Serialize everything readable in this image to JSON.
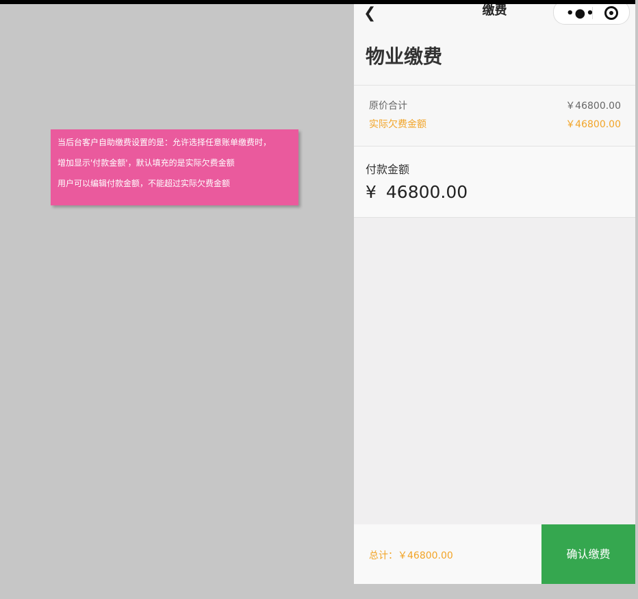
{
  "note": {
    "lines": [
      "当后台客户自助缴费设置的是：允许选择任意账单缴费时，",
      "增加显示'付款金额'，默认填充的是实际欠费金额",
      "用户可以编辑付款金额，不能超过实际欠费金额"
    ]
  },
  "nav": {
    "back_icon": "chevron-left-icon",
    "title": "缴费",
    "more_icon": "more-dots-icon",
    "target_icon": "target-icon"
  },
  "header": {
    "title": "物业缴费"
  },
  "summary": {
    "original_label": "原价合计",
    "original_value": "￥46800.00",
    "actual_label": "实际欠费金额",
    "actual_value": "￥46800.00"
  },
  "payment": {
    "label": "付款金额",
    "currency": "¥",
    "amount": "46800.00"
  },
  "footer": {
    "total": "总计：￥46800.00",
    "confirm": "确认缴费"
  },
  "colors": {
    "accent_orange": "#f2a427",
    "confirm_green": "#35a74f",
    "note_pink": "#ea5a9d",
    "background_gray": "#c6c6c6"
  }
}
